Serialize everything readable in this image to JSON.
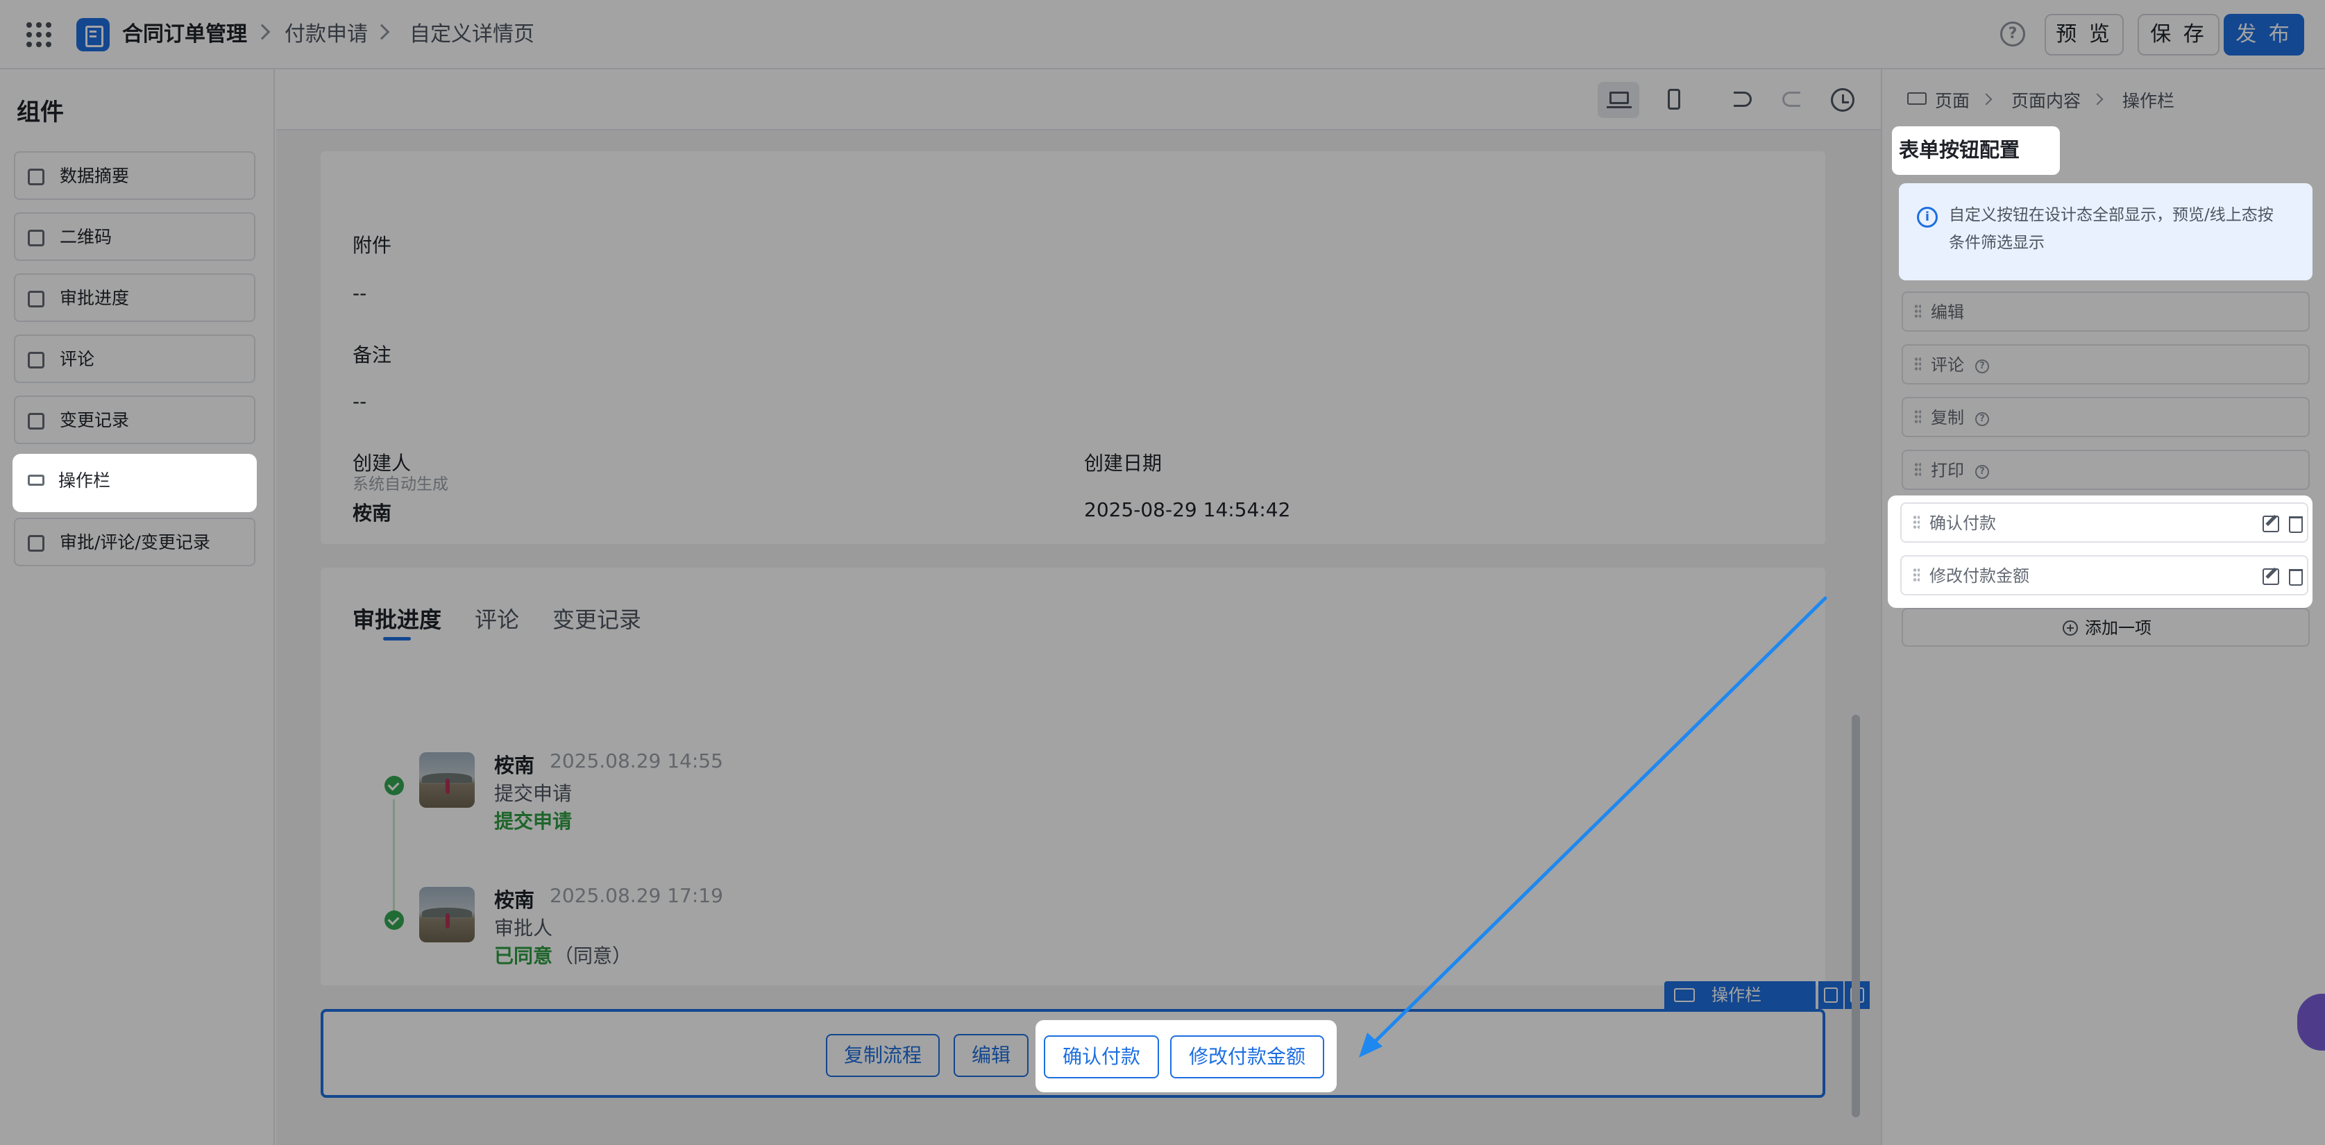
{
  "header": {
    "breadcrumb": [
      "合同订单管理",
      "付款申请",
      "自定义详情页"
    ],
    "preview_label": "预 览",
    "save_label": "保 存",
    "publish_label": "发 布"
  },
  "components": {
    "title": "组件",
    "items": [
      {
        "label": "数据摘要"
      },
      {
        "label": "二维码"
      },
      {
        "label": "审批进度"
      },
      {
        "label": "评论"
      },
      {
        "label": "变更记录"
      },
      {
        "label": "操作栏"
      },
      {
        "label": "审批/评论/变更记录"
      }
    ]
  },
  "detail": {
    "attachment_label": "附件",
    "attachment_value": "--",
    "remark_label": "备注",
    "remark_value": "--",
    "creator_label": "创建人",
    "creator_value": "桉南",
    "creator_hint": "系统自动生成",
    "date_label": "创建日期",
    "date_value": "2025-08-29 14:54:42"
  },
  "approval": {
    "tabs": [
      {
        "label": "审批进度"
      },
      {
        "label": "评论"
      },
      {
        "label": "变更记录"
      }
    ],
    "records": [
      {
        "name": "桉南",
        "time": "2025.08.29 14:55",
        "step": "提交申请",
        "status": "提交申请",
        "note": ""
      },
      {
        "name": "桉南",
        "time": "2025.08.29 17:19",
        "step": "审批人",
        "status": "已同意",
        "note": "（同意）"
      }
    ]
  },
  "action_bar": {
    "tag_label": "操作栏",
    "buttons": [
      {
        "label": "复制流程"
      },
      {
        "label": "编辑"
      },
      {
        "label": "确认付款"
      },
      {
        "label": "修改付款金额"
      }
    ]
  },
  "config": {
    "breadcrumb": [
      "页面",
      "页面内容",
      "操作栏"
    ],
    "section_title": "表单按钮配置",
    "info": "自定义按钮在设计态全部显示，预览/线上态按条件筛选显示",
    "items": [
      {
        "label": "编辑"
      },
      {
        "label": "评论"
      },
      {
        "label": "复制"
      },
      {
        "label": "打印"
      },
      {
        "label": "确认付款"
      },
      {
        "label": "修改付款金额"
      }
    ],
    "add_label": "添加一项"
  },
  "colors": {
    "primary": "#1e6fe0",
    "success": "#2f9e44",
    "overlay": "rgba(0,0,0,0.36)"
  }
}
